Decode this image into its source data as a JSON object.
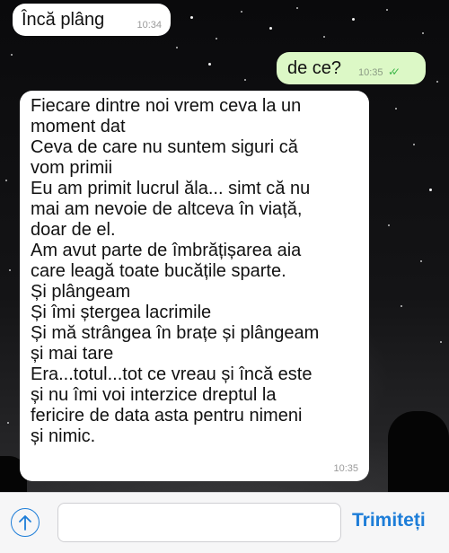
{
  "messages": [
    {
      "direction": "incoming",
      "text": "Încă plâng",
      "time": "10:34"
    },
    {
      "direction": "outgoing",
      "text": "de ce?",
      "time": "10:35",
      "status": "read"
    },
    {
      "direction": "incoming",
      "text": "Fiecare dintre noi vrem ceva la un\nmoment dat\nCeva de care nu suntem siguri că\nvom primii\nEu am primit lucrul ăla... simt că nu\nmai am nevoie de altceva în viață,\ndoar de el.\nAm avut parte de îmbrățișarea aia\ncare leagă toate bucățile sparte.\nȘi plângeam\nȘi îmi ștergea lacrimile\nȘi mă strângea în brațe și plângeam\nși mai tare\nEra...totul...tot ce vreau și încă este\nși nu îmi voi interzice dreptul la\nfericire de data asta pentru nimeni\nși nimic.",
      "time": "10:35"
    }
  ],
  "composer": {
    "attach_icon": "arrow-up-circle-icon",
    "input_placeholder": "",
    "send_label": "Trimiteți"
  },
  "colors": {
    "accent": "#1d7dd8",
    "outgoing_bubble": "#dcf8c6",
    "incoming_bubble": "#ffffff",
    "read_ticks": "#3fb84a"
  }
}
